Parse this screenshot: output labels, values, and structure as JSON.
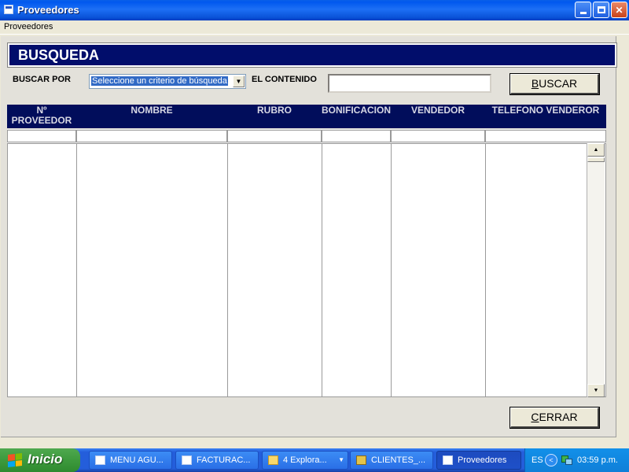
{
  "window": {
    "title": "Proveedores",
    "buttons": {
      "minimize": "minimize",
      "maximize": "restore",
      "close": "close"
    }
  },
  "menu": {
    "items": [
      "Proveedores"
    ]
  },
  "search": {
    "header": "BUSQUEDA",
    "buscar_por_label": "BUSCAR POR",
    "criteria_selected": "Seleccione un criterio de búsqueda",
    "contenido_label": "EL CONTENIDO",
    "contenido_value": "",
    "buscar_button": {
      "underlined": "B",
      "rest": "USCAR"
    }
  },
  "grid": {
    "columns": [
      "Nº PROVEEDOR",
      "NOMBRE",
      "RUBRO",
      "BONIFICACION",
      "VENDEDOR",
      "TELEFONO VENDEROR"
    ],
    "rows": []
  },
  "footer": {
    "cerrar_button": {
      "underlined": "C",
      "rest": "ERRAR"
    }
  },
  "taskbar": {
    "start_label": "Inicio",
    "tasks": [
      {
        "label": "MENU AGU...",
        "icon": "window-icon",
        "active": false
      },
      {
        "label": "FACTURAC...",
        "icon": "window-icon",
        "active": false
      },
      {
        "label": "4 Explora...",
        "icon": "folder-icon",
        "active": false
      },
      {
        "label": "CLIENTES_...",
        "icon": "app-icon",
        "active": false
      },
      {
        "label": "Proveedores",
        "icon": "window-icon",
        "active": true
      }
    ],
    "tray": {
      "language": "ES",
      "time": "03:59 p.m."
    }
  },
  "colors": {
    "header_bg": "#010d6b",
    "grid_header_bg": "#010d5b",
    "selection": "#316ac5",
    "titlebar": "#0058ee",
    "taskbar": "#245edb",
    "start_green": "#3d9a3d"
  }
}
